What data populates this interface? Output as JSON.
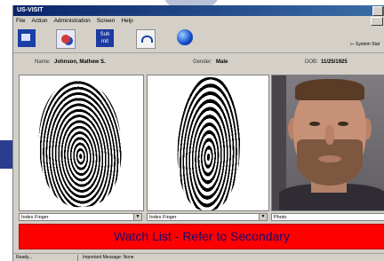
{
  "window": {
    "title": "US-VISIT"
  },
  "menu": [
    "File",
    "Action",
    "Administration",
    "Screen",
    "Help"
  ],
  "toolbar": {
    "buttons": [
      {
        "icon": "capture-icon"
      },
      {
        "icon": "fingerprint-scan-icon"
      },
      {
        "icon": "submit-icon",
        "label": "Sub\nmit"
      },
      {
        "icon": "refresh-icon"
      },
      {
        "icon": "globe-icon"
      }
    ],
    "system_status": "System Stat"
  },
  "person": {
    "name_label": "Name:",
    "name": "Johnson, Mathew S.",
    "gender_label": "Gender:",
    "gender": "Male",
    "dob_label": "DOB:",
    "dob": "11/25/1925"
  },
  "selects": [
    "Index Finger",
    "Index Finger",
    "Photo"
  ],
  "alert": "Watch List - Refer to Secondary",
  "status": {
    "left": "Ready...",
    "message": "Important Message: None"
  },
  "colors": {
    "alert": "#ff0000",
    "alert_text": "#1a0a6e",
    "titlebar": "#0a246a"
  }
}
